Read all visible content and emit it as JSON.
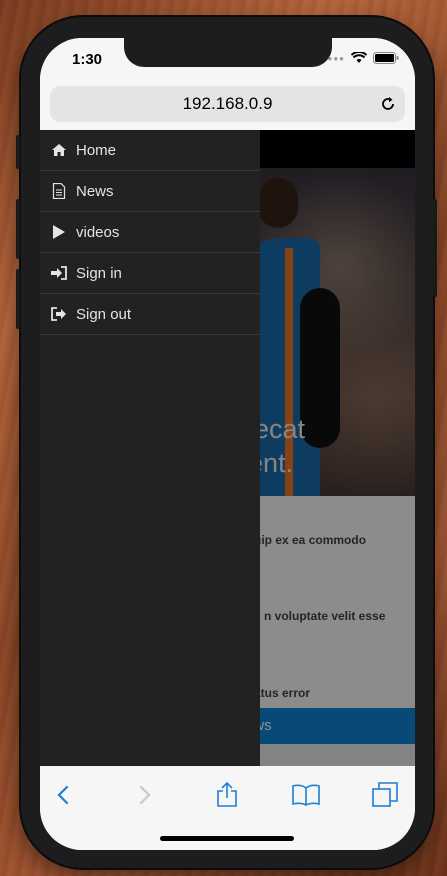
{
  "status_bar": {
    "time": "1:30"
  },
  "address_bar": {
    "url": "192.168.0.9"
  },
  "hero": {
    "text_line1": "ccaecat",
    "text_line2": "oident."
  },
  "content_items": [
    {
      "text": "liquip ex ea commodo"
    },
    {
      "text": "n voluptate velit esse"
    },
    {
      "text": "atus error"
    }
  ],
  "blue_bar": {
    "label": "ews"
  },
  "drawer": {
    "items": [
      {
        "label": "Home",
        "icon": "home-icon"
      },
      {
        "label": "News",
        "icon": "document-icon"
      },
      {
        "label": "videos",
        "icon": "play-icon"
      },
      {
        "label": "Sign in",
        "icon": "sign-in-icon"
      },
      {
        "label": "Sign out",
        "icon": "sign-out-icon"
      }
    ]
  },
  "toolbar": {
    "icons": [
      "back-icon",
      "forward-icon",
      "share-icon",
      "bookmarks-icon",
      "tabs-icon"
    ]
  },
  "colors": {
    "drawer_bg": "#222222",
    "accent_blue": "#0d87d9",
    "toolbar_icon": "#1e7fd6"
  }
}
